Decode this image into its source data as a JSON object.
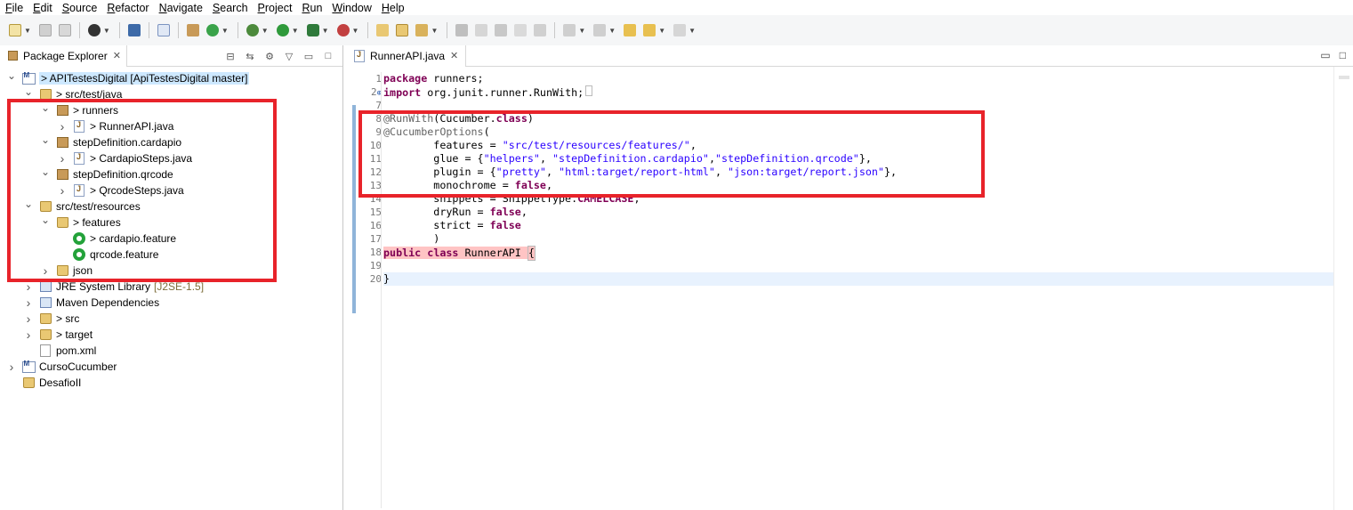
{
  "menu": [
    "File",
    "Edit",
    "Source",
    "Refactor",
    "Navigate",
    "Search",
    "Project",
    "Run",
    "Window",
    "Help"
  ],
  "package_explorer": {
    "tab_label": "Package Explorer",
    "tree": [
      {
        "label": "> APITestesDigital [ApiTestesDigital master]",
        "level": 0,
        "expanded": true,
        "icon": "project-icon",
        "selected": true
      },
      {
        "label": "> src/test/java",
        "level": 1,
        "expanded": true,
        "icon": "source-folder-icon"
      },
      {
        "label": "> runners",
        "level": 2,
        "expanded": true,
        "icon": "package-icon"
      },
      {
        "label": "> RunnerAPI.java",
        "level": 3,
        "expanded": false,
        "icon": "java-file-icon"
      },
      {
        "label": "stepDefinition.cardapio",
        "level": 2,
        "expanded": true,
        "icon": "package-icon"
      },
      {
        "label": "> CardapioSteps.java",
        "level": 3,
        "expanded": false,
        "icon": "java-file-icon"
      },
      {
        "label": "stepDefinition.qrcode",
        "level": 2,
        "expanded": true,
        "icon": "package-icon"
      },
      {
        "label": "> QrcodeSteps.java",
        "level": 3,
        "expanded": false,
        "icon": "java-file-icon"
      },
      {
        "label": "src/test/resources",
        "level": 1,
        "expanded": true,
        "icon": "source-folder-icon"
      },
      {
        "label": "> features",
        "level": 2,
        "expanded": true,
        "icon": "folder-icon"
      },
      {
        "label": "> cardapio.feature",
        "level": 3,
        "expanded": null,
        "icon": "cucumber-file-icon"
      },
      {
        "label": "qrcode.feature",
        "level": 3,
        "expanded": null,
        "icon": "cucumber-file-icon"
      },
      {
        "label": "json",
        "level": 2,
        "expanded": false,
        "icon": "folder-icon"
      },
      {
        "label": "JRE System Library",
        "decoration": "[J2SE-1.5]",
        "level": 1,
        "expanded": false,
        "icon": "library-icon"
      },
      {
        "label": "Maven Dependencies",
        "level": 1,
        "expanded": false,
        "icon": "library-icon"
      },
      {
        "label": "> src",
        "level": 1,
        "expanded": false,
        "icon": "folder-icon"
      },
      {
        "label": "> target",
        "level": 1,
        "expanded": false,
        "icon": "folder-icon"
      },
      {
        "label": "pom.xml",
        "level": 1,
        "expanded": null,
        "icon": "xml-file-icon"
      },
      {
        "label": "CursoCucumber",
        "level": 0,
        "expanded": false,
        "icon": "project-icon"
      },
      {
        "label": "DesafioII",
        "level": 0,
        "expanded": null,
        "icon": "folder-icon"
      }
    ]
  },
  "editor": {
    "tab_label": "RunnerAPI.java",
    "line_numbers": [
      "1",
      "2",
      "7",
      "8",
      "9",
      "10",
      "11",
      "12",
      "13",
      "14",
      "15",
      "16",
      "17",
      "18",
      "19",
      "20"
    ],
    "lines": [
      [
        {
          "t": "package",
          "c": "kw"
        },
        {
          "t": " runners;",
          "c": ""
        }
      ],
      [
        {
          "t": "import",
          "c": "kw"
        },
        {
          "t": " org.junit.runner.RunWith;",
          "c": ""
        }
      ],
      [],
      [
        {
          "t": "@RunWith",
          "c": "ann"
        },
        {
          "t": "(Cucumber.",
          "c": ""
        },
        {
          "t": "class",
          "c": "kw"
        },
        {
          "t": ")",
          "c": ""
        }
      ],
      [
        {
          "t": "@CucumberOptions",
          "c": "ann"
        },
        {
          "t": "(",
          "c": ""
        }
      ],
      [
        {
          "t": "        features = ",
          "c": ""
        },
        {
          "t": "\"src/test/resources/features/\"",
          "c": "str"
        },
        {
          "t": ",",
          "c": ""
        }
      ],
      [
        {
          "t": "        glue = {",
          "c": ""
        },
        {
          "t": "\"helpers\"",
          "c": "str"
        },
        {
          "t": ", ",
          "c": ""
        },
        {
          "t": "\"stepDefinition.cardapio\"",
          "c": "str"
        },
        {
          "t": ",",
          "c": ""
        },
        {
          "t": "\"stepDefinition.qrcode\"",
          "c": "str"
        },
        {
          "t": "},",
          "c": ""
        }
      ],
      [
        {
          "t": "        plugin = {",
          "c": ""
        },
        {
          "t": "\"pretty\"",
          "c": "str"
        },
        {
          "t": ", ",
          "c": ""
        },
        {
          "t": "\"html:target/report-html\"",
          "c": "str"
        },
        {
          "t": ", ",
          "c": ""
        },
        {
          "t": "\"json:target/report.json\"",
          "c": "str"
        },
        {
          "t": "},",
          "c": ""
        }
      ],
      [
        {
          "t": "        monochrome = ",
          "c": ""
        },
        {
          "t": "false",
          "c": "kw"
        },
        {
          "t": ",",
          "c": ""
        }
      ],
      [
        {
          "t": "        snippets = SnippetType.",
          "c": ""
        },
        {
          "t": "CAMELCASE",
          "c": "kw"
        },
        {
          "t": ",",
          "c": ""
        }
      ],
      [
        {
          "t": "        dryRun = ",
          "c": ""
        },
        {
          "t": "false",
          "c": "kw"
        },
        {
          "t": ",",
          "c": ""
        }
      ],
      [
        {
          "t": "        strict = ",
          "c": ""
        },
        {
          "t": "false",
          "c": "kw"
        }
      ],
      [
        {
          "t": "        )",
          "c": ""
        }
      ],
      [
        {
          "t": "public",
          "c": "kw hl"
        },
        {
          "t": " ",
          "c": "hl"
        },
        {
          "t": "class",
          "c": "kw hl"
        },
        {
          "t": " RunnerAPI ",
          "c": "hl"
        },
        {
          "t": "{",
          "c": "brace"
        }
      ],
      [],
      [
        {
          "t": "}",
          "c": ""
        }
      ]
    ]
  },
  "colors": {
    "highlight_box": "#e8232a",
    "selection": "#cde8ff",
    "keyword": "#7f0055",
    "string": "#2a00ff"
  }
}
